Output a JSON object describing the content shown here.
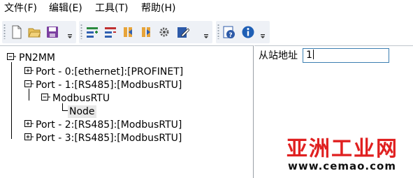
{
  "menu": {
    "items": [
      {
        "label": "文件(F)"
      },
      {
        "label": "编辑(E)"
      },
      {
        "label": "工具(T)"
      },
      {
        "label": "帮助(H)"
      }
    ]
  },
  "toolbar": {
    "groups": [
      {
        "buttons": [
          "new-file-icon",
          "open-folder-icon",
          "save-icon"
        ]
      },
      {
        "buttons": [
          "add-item-icon",
          "remove-item-icon",
          "import-icon",
          "export-icon",
          "settings-gear-icon",
          "edit-pen-icon"
        ]
      },
      {
        "buttons": [
          "configure-help-icon",
          "info-icon"
        ]
      }
    ]
  },
  "tree": {
    "root": "PN2MM",
    "ports": [
      {
        "label": "Port - 0:[ethernet]:[PROFINET]"
      },
      {
        "label": "Port - 1:[RS485]:[ModbusRTU]"
      },
      {
        "label": "Port - 2:[RS485]:[ModbusRTU]"
      },
      {
        "label": "Port - 3:[RS485]:[ModbusRTU]"
      }
    ],
    "port1_child": "ModbusRTU",
    "port1_grandchild": "Node"
  },
  "properties": {
    "slave_address_label": "从站地址",
    "slave_address_value": "1"
  },
  "watermark": {
    "title": "亚洲工业网",
    "url": "www.cemao.com"
  },
  "colors": {
    "toolbar_bg": "#eef1f6",
    "input_border": "#3c7fb1",
    "watermark_red": "#e02020"
  }
}
